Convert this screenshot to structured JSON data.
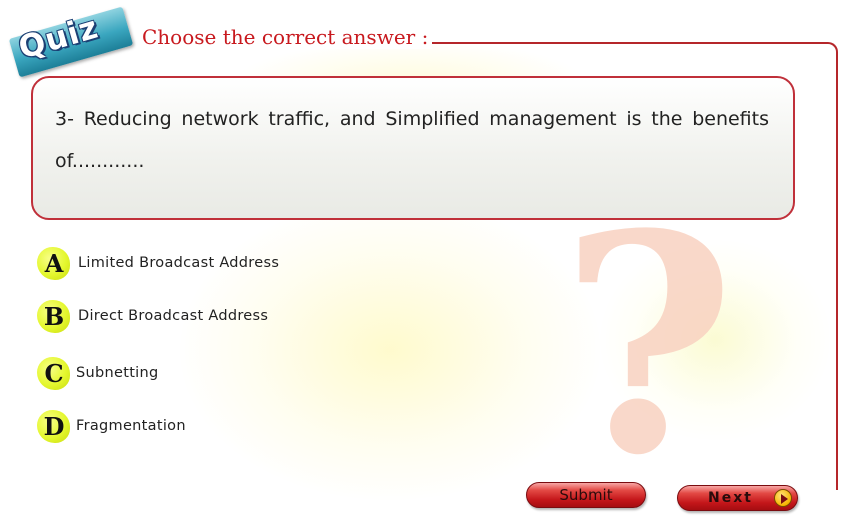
{
  "header": {
    "badge": "Quiz",
    "title": "Choose the correct answer :"
  },
  "question": {
    "text": "3- Reducing network traffic, and Simplified management is the benefits of............"
  },
  "options": [
    {
      "letter": "A",
      "text": "Limited Broadcast Address"
    },
    {
      "letter": "B",
      "text": "Direct Broadcast Address"
    },
    {
      "letter": "C",
      "text": "Subnetting"
    },
    {
      "letter": "D",
      "text": "Fragmentation"
    }
  ],
  "decor": {
    "symbol": "?"
  },
  "buttons": {
    "submit": "Submit",
    "next": "Next"
  },
  "colors": {
    "accent_red": "#c8191e",
    "option_badge": "#e4f72e",
    "badge_teal": "#3aa6bf"
  }
}
